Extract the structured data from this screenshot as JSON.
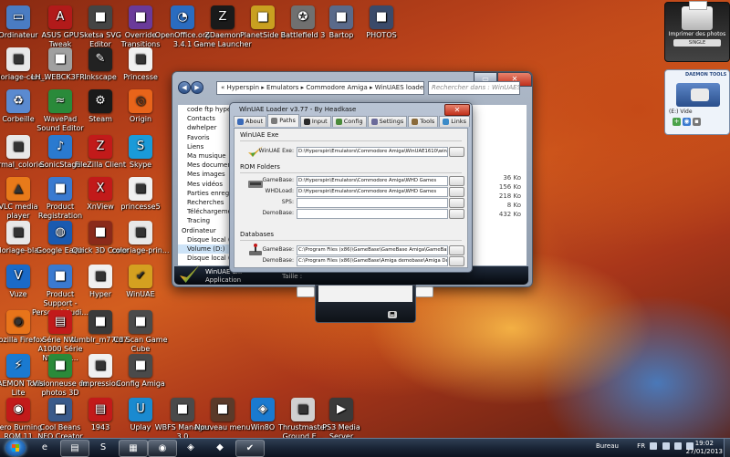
{
  "desktop_icons": [
    {
      "label": "Ordinateur",
      "icon": "computer-icon",
      "color": "#4a7cc2"
    },
    {
      "label": "ASUS GPU Tweak",
      "icon": "asus-gpu-icon",
      "color": "#b21a1a"
    },
    {
      "label": "Sketsa SVG Editor",
      "icon": "sketsa-icon",
      "color": "#444444"
    },
    {
      "label": "Override Transitions",
      "icon": "override-icon",
      "color": "#6a3a9a"
    },
    {
      "label": "OpenOffice.org 3.4.1",
      "icon": "openoffice-icon",
      "color": "#2a6cc0"
    },
    {
      "label": "ZDaemon Game Launcher",
      "icon": "zdaemon-icon",
      "color": "#1a1a1a"
    },
    {
      "label": "PlanetSide 2",
      "icon": "planetside-icon",
      "color": "#c9a020"
    },
    {
      "label": "Battlefield 3",
      "icon": "battlefield-icon",
      "color": "#707070"
    },
    {
      "label": "Bartop",
      "icon": "bartop-folder-icon",
      "color": "#5a6a8a"
    },
    {
      "label": "PHOTOS",
      "icon": "photos-folder-icon",
      "color": "#3a4a6a"
    },
    {
      "label": "coloriage-cen...",
      "icon": "coloriage-image-icon",
      "color": "#e8e8e8"
    },
    {
      "label": "LH_WEBCK3FR...",
      "icon": "lh-webck-icon",
      "color": "#a0a0a0"
    },
    {
      "label": "Inkscape",
      "icon": "inkscape-icon",
      "color": "#222222"
    },
    {
      "label": "Princesse",
      "icon": "princesse-icon",
      "color": "#f0f0f0"
    },
    {
      "label": "Corbeille",
      "icon": "recycle-bin-icon",
      "color": "#5a8ad0"
    },
    {
      "label": "WavePad Sound Editor",
      "icon": "wavepad-icon",
      "color": "#2a8a3a"
    },
    {
      "label": "Steam",
      "icon": "steam-icon",
      "color": "#1a1a1a"
    },
    {
      "label": "Origin",
      "icon": "origin-icon",
      "color": "#e8641a"
    },
    {
      "label": "normal_colorie...",
      "icon": "normal-colorie-icon",
      "color": "#e8e8e8"
    },
    {
      "label": "SonicStage",
      "icon": "sonicstage-icon",
      "color": "#2a7ad0"
    },
    {
      "label": "FileZilla Client",
      "icon": "filezilla-icon",
      "color": "#c21a1a"
    },
    {
      "label": "Skype",
      "icon": "skype-icon",
      "color": "#1a9ad8"
    },
    {
      "label": "VLC media player",
      "icon": "vlc-icon",
      "color": "#e87a1a"
    },
    {
      "label": "Product Registration",
      "icon": "product-registration-icon",
      "color": "#3a7ad0"
    },
    {
      "label": "XnView",
      "icon": "xnview-icon",
      "color": "#c21a1a"
    },
    {
      "label": "princesse5",
      "icon": "princesse5-icon",
      "color": "#f0f0f0"
    },
    {
      "label": "coloriage-bla...",
      "icon": "coloriage-bla-icon",
      "color": "#e8e8e8"
    },
    {
      "label": "Google Earth",
      "icon": "google-earth-icon",
      "color": "#1a5ab0"
    },
    {
      "label": "Quick 3D Cover",
      "icon": "quick3dcover-icon",
      "color": "#8a2a1a"
    },
    {
      "label": "coloriage-prin...",
      "icon": "coloriage-prin-icon",
      "color": "#e8e8e8"
    },
    {
      "label": "Vuze",
      "icon": "vuze-icon",
      "color": "#1a6ac8"
    },
    {
      "label": "Product Support -Personal Audi...",
      "icon": "product-support-icon",
      "color": "#3a7ad0"
    },
    {
      "label": "Hyper",
      "icon": "hyper-icon",
      "color": "#f0f0f0"
    },
    {
      "label": "WinUAE",
      "icon": "winuae-icon",
      "color": "#d4a020"
    },
    {
      "label": "Mozilla Firefox",
      "icon": "firefox-icon",
      "color": "#e8741a"
    },
    {
      "label": "Série NW-A1000 Série NW-A80...",
      "icon": "pdf-icon",
      "color": "#c21a1a"
    },
    {
      "label": "tumblr_m77r97...",
      "icon": "tumblr-image-icon",
      "color": "#3a3a3a"
    },
    {
      "label": "Cd Scan Game Cube",
      "icon": "cdscan-icon",
      "color": "#4a4a4a"
    },
    {
      "label": "DAEMON Tools Lite",
      "icon": "daemon-tools-icon",
      "color": "#1a7ad0"
    },
    {
      "label": "Visionneuse de photos 3D Vision",
      "icon": "3dvision-icon",
      "color": "#2a8a3a"
    },
    {
      "label": "impression",
      "icon": "impression-icon",
      "color": "#f0f0f0"
    },
    {
      "label": "Config Amiga",
      "icon": "config-amiga-icon",
      "color": "#4a4a4a"
    },
    {
      "label": "Nero Burning ROM 11",
      "icon": "nero-icon",
      "color": "#c21a1a"
    },
    {
      "label": "Cool Beans NFO Creator",
      "icon": "nfo-creator-icon",
      "color": "#3a5a8a"
    },
    {
      "label": "1943",
      "icon": "pdf-1943-icon",
      "color": "#c21a1a"
    },
    {
      "label": "Uplay",
      "icon": "uplay-icon",
      "color": "#1a8ad0"
    },
    {
      "label": "WBFS Manager 3.0",
      "icon": "wbfs-icon",
      "color": "#4a4a4a"
    },
    {
      "label": "Nouveau menu",
      "icon": "nouveau-menu-icon",
      "color": "#5a3a2a"
    },
    {
      "label": "Win8O",
      "icon": "win8o-icon",
      "color": "#1a7ad0"
    },
    {
      "label": "Thrustmaster Ground E...",
      "icon": "thrustmaster-icon",
      "color": "#d0d0d0"
    },
    {
      "label": "PS3 Media Server",
      "icon": "ps3-media-server-icon",
      "color": "#3a3a3a"
    }
  ],
  "explorer": {
    "address": "« Hyperspin ▸ Emulators ▸ Commodore Amiga ▸ WinUAES loader ▸",
    "search_placeholder": "Rechercher dans : WinUAES loader",
    "tree": [
      "code ftp hype...",
      "Contacts",
      "dwhelper",
      "Favoris",
      "Liens",
      "Ma musique",
      "Mes documen...",
      "Mes images",
      "Mes vidéos",
      "Parties enreg...",
      "Recherches",
      "Téléchargeme...",
      "Tracing",
      "Ordinateur",
      "Disque local (...",
      "Volume (D:)",
      "Disque local (..."
    ],
    "sizes": [
      "36 Ko",
      "156 Ko",
      "218 Ko",
      "8 Ko",
      "432 Ko"
    ],
    "status_name": "WinUAE L...",
    "status_type": "Application",
    "status_size": "Taille :"
  },
  "loader": {
    "title": "WinUAE Loader v3.77 - By Headkase",
    "close": "✕",
    "tabs": [
      {
        "label": "About",
        "color": "#3a6ab8"
      },
      {
        "label": "Paths",
        "color": "#7a7a7a"
      },
      {
        "label": "Input",
        "color": "#2a2a2a"
      },
      {
        "label": "Config",
        "color": "#4a8a3a"
      },
      {
        "label": "Settings",
        "color": "#6a6a9a"
      },
      {
        "label": "Tools",
        "color": "#8a6a3a"
      },
      {
        "label": "Links",
        "color": "#3a8ac8"
      }
    ],
    "active_tab": "Paths",
    "sections": {
      "exe": "WinUAE Exe",
      "rom": "ROM Folders",
      "db": "Databases"
    },
    "exe": {
      "label": "WinUAE Exe:",
      "value": "D:\\Hyperspin\\Emulators\\Commodore Amiga\\WinUAE1610\\winuae.exe"
    },
    "rom_folders": [
      {
        "label": "GameBase:",
        "value": "D:\\Hyperspin\\Emulators\\Commodore Amiga\\WHD Games"
      },
      {
        "label": "WHDLoad:",
        "value": "D:\\Hyperspin\\Emulators\\Commodore Amiga\\WHD Games"
      },
      {
        "label": "SPS:",
        "value": ""
      },
      {
        "label": "DemoBase:",
        "value": ""
      }
    ],
    "databases": [
      {
        "label": "GameBase:",
        "value": "C:\\Program Files (x86)\\GameBase\\GameBase Amiga\\GameBase Amiga"
      },
      {
        "label": "DemoBase:",
        "value": "C:\\Program Files (x86)\\GameBase\\Amiga demobase\\Amiga Demobase"
      }
    ]
  },
  "printer_gadget": {
    "label": "Imprimer des photos",
    "selector": "SINGLE"
  },
  "daemon_gadget": {
    "title": "DAEMON TOOLS",
    "drive": "(E:) Vide"
  },
  "taskbar": {
    "apps": [
      {
        "icon": "ie-icon",
        "glyph": "e",
        "open": false
      },
      {
        "icon": "explorer-icon",
        "glyph": "▤",
        "open": true
      },
      {
        "icon": "skype-taskbar-icon",
        "glyph": "S",
        "open": false
      },
      {
        "icon": "folder-taskbar-icon",
        "glyph": "▦",
        "open": true
      },
      {
        "icon": "firefox-taskbar-icon",
        "glyph": "◉",
        "open": true
      },
      {
        "icon": "game-taskbar-icon",
        "glyph": "◈",
        "open": false
      },
      {
        "icon": "media-taskbar-icon",
        "glyph": "◆",
        "open": false
      },
      {
        "icon": "winuae-taskbar-icon",
        "glyph": "✔",
        "open": true
      }
    ],
    "tray_label": "Bureau",
    "lang": "FR",
    "time": "19:02",
    "date": "27/01/2013"
  }
}
